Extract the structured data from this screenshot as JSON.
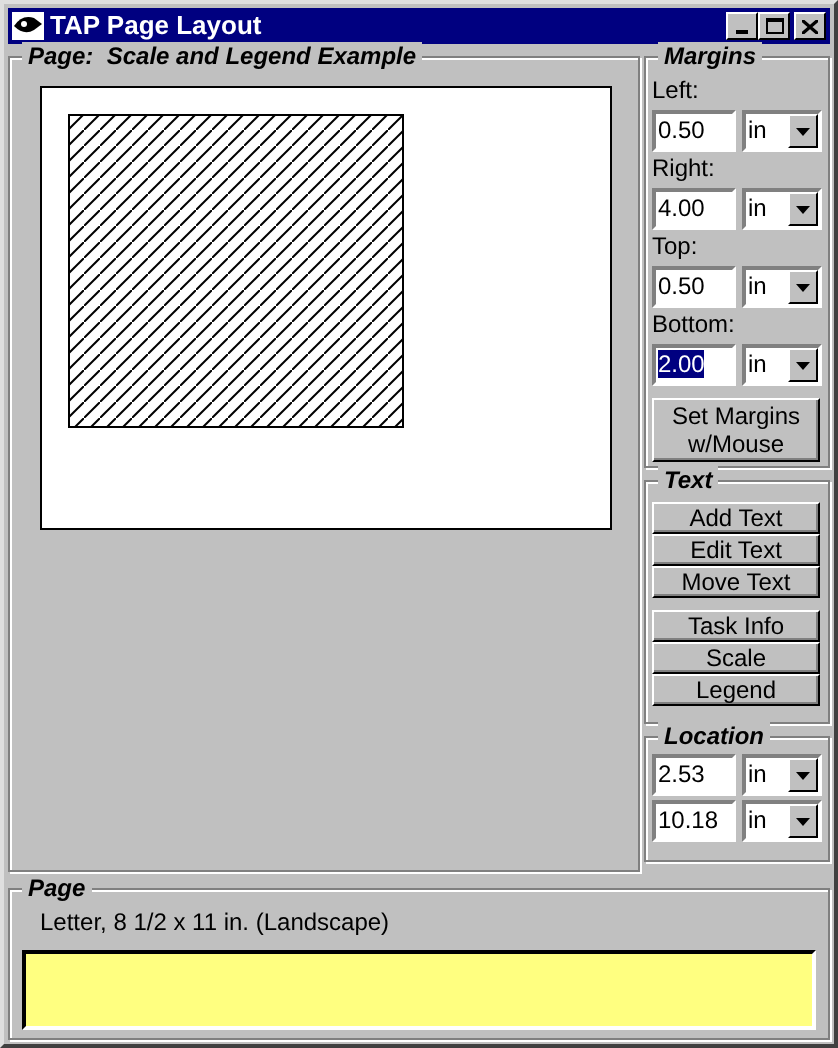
{
  "window": {
    "title": "TAP Page Layout"
  },
  "page_preview": {
    "legend": "Page:  Scale and Legend Example"
  },
  "margins": {
    "legend": "Margins",
    "fields": [
      {
        "label": "Left:",
        "value": "0.50",
        "unit": "in",
        "selected": false
      },
      {
        "label": "Right:",
        "value": "4.00",
        "unit": "in",
        "selected": false
      },
      {
        "label": "Top:",
        "value": "0.50",
        "unit": "in",
        "selected": false
      },
      {
        "label": "Bottom:",
        "value": "2.00",
        "unit": "in",
        "selected": true
      }
    ],
    "set_button": "Set Margins w/Mouse"
  },
  "text": {
    "legend": "Text",
    "button_groups": [
      [
        "Add Text",
        "Edit Text",
        "Move Text"
      ],
      [
        "Task Info",
        "Scale",
        "Legend"
      ]
    ]
  },
  "location": {
    "legend": "Location",
    "fields": [
      {
        "value": "2.53",
        "unit": "in"
      },
      {
        "value": "10.18",
        "unit": "in"
      }
    ]
  },
  "page_info": {
    "legend": "Page",
    "description": "Letter, 8 1/2 x 11 in. (Landscape)"
  }
}
